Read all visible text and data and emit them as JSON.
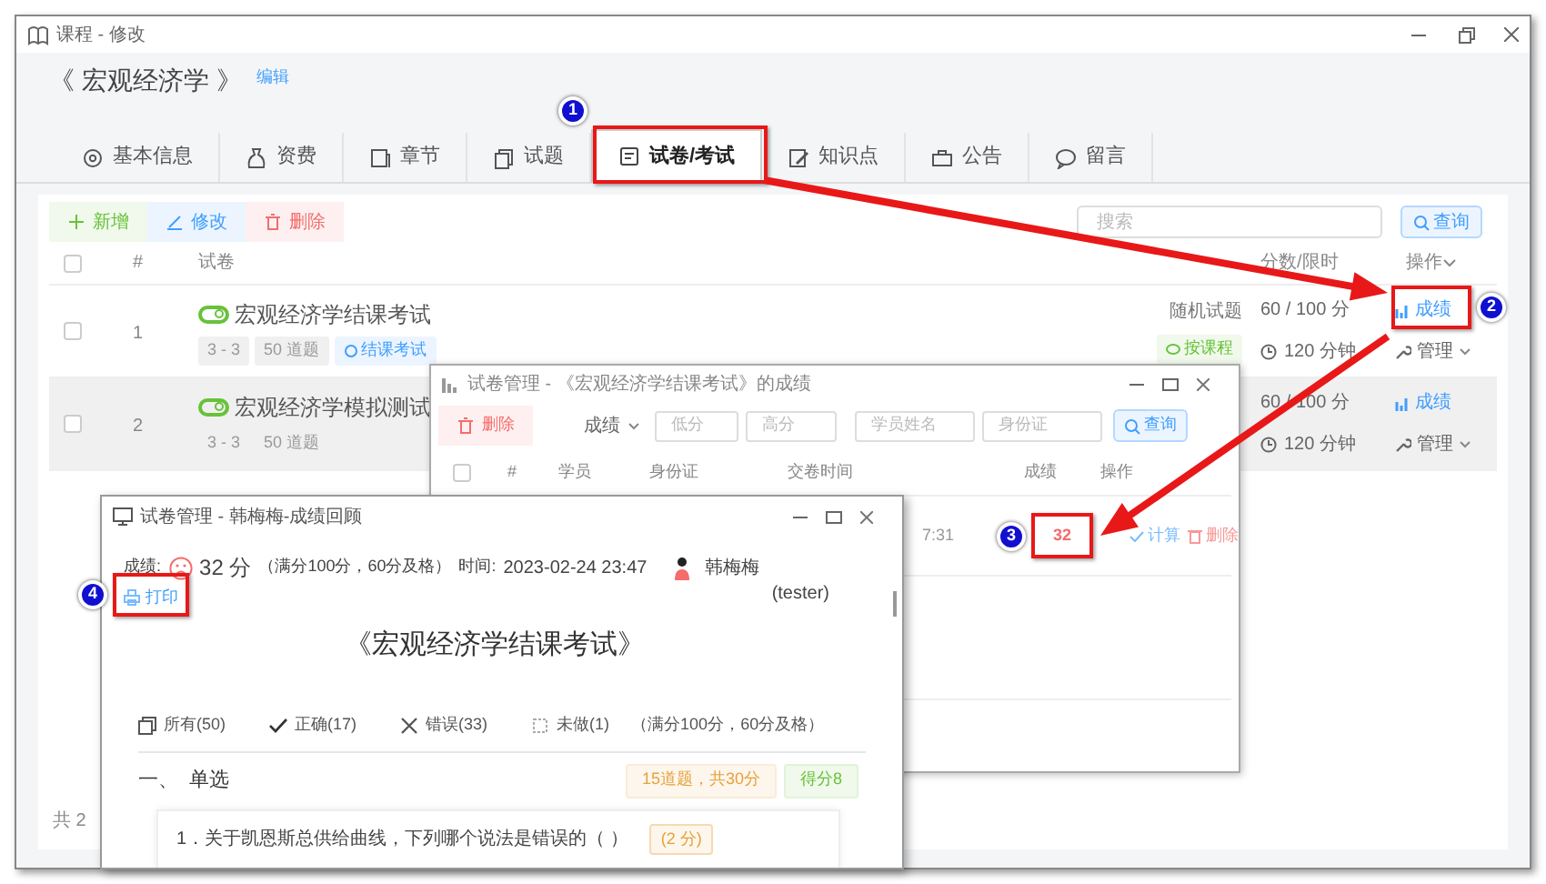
{
  "window": {
    "title": "课程 - 修改"
  },
  "course": {
    "title": "《 宏观经济学 》",
    "edit_link": "编辑"
  },
  "tabs": [
    {
      "label": "基本信息",
      "selected": false
    },
    {
      "label": "资费",
      "selected": false
    },
    {
      "label": "章节",
      "selected": false
    },
    {
      "label": "试题",
      "selected": false
    },
    {
      "label": "试卷/考试",
      "selected": true
    },
    {
      "label": "知识点",
      "selected": false
    },
    {
      "label": "公告",
      "selected": false
    },
    {
      "label": "留言",
      "selected": false
    }
  ],
  "toolbar": {
    "buttons": [
      {
        "label": "新增",
        "kind": "add"
      },
      {
        "label": "修改",
        "kind": "edit"
      },
      {
        "label": "删除",
        "kind": "delete"
      }
    ],
    "search_placeholder": "搜索",
    "search_button": "查询"
  },
  "table": {
    "select_all_checked": false,
    "columns": [
      "#",
      "试卷",
      "分数/限时",
      "操作"
    ],
    "rows": [
      {
        "checked": false,
        "index": "1",
        "title": "宏观经济学结课考试",
        "enabled": true,
        "highlighted": false,
        "tags": [
          "3 - 3",
          "50 道题"
        ],
        "tag_link": "结课考试",
        "type": "随机试题",
        "type_tag": "按课程",
        "score": "60 / 100 分",
        "time": "120 分钟",
        "actions": [
          "成绩",
          "管理"
        ]
      },
      {
        "checked": false,
        "index": "2",
        "title": "宏观经济学模拟测试",
        "enabled": true,
        "highlighted": true,
        "tags": [
          "3 - 3",
          "50 道题"
        ],
        "score": "60 / 100 分",
        "time": "120 分钟",
        "actions": [
          "成绩",
          "管理"
        ]
      }
    ],
    "footer": "共 2"
  },
  "scores_window": {
    "title": "试卷管理 - 《宏观经济学结课考试》的成绩",
    "delete_button": "删除",
    "sort": "成绩",
    "filters": [
      "低分",
      "高分",
      "学员姓名",
      "身份证"
    ],
    "query_button": "查询",
    "select_all_checked": false,
    "columns": [
      "#",
      "学员",
      "身份证",
      "交卷时间",
      "成绩",
      "操作"
    ],
    "rows": [
      {
        "time": "7:31",
        "score": "32",
        "actions": [
          "计算",
          "删除"
        ]
      }
    ]
  },
  "review_window": {
    "title": "试卷管理 - 韩梅梅-成绩回顾",
    "score_label": "成绩:",
    "passed": false,
    "score": "32 分",
    "score_note": "（满分100分，60分及格）",
    "time_label": "时间:",
    "time": "2023-02-24 23:47",
    "user_name": "韩梅梅",
    "user_id": "(tester)",
    "print": "打印",
    "exam_title": "《宏观经济学结课考试》",
    "filters": [
      {
        "label": "所有(50)",
        "kind": "all"
      },
      {
        "label": "正确(17)",
        "kind": "correct"
      },
      {
        "label": "错误(33)",
        "kind": "wrong"
      },
      {
        "label": "未做(1)",
        "kind": "undone"
      }
    ],
    "filter_note": "（满分100分，60分及格）",
    "section": {
      "title": "一、  单选",
      "count_tag": "15道题，共30分",
      "score_tag": "得分8"
    },
    "question": {
      "text": "1．关于凯恩斯总供给曲线，下列哪个说法是错误的（ ）",
      "points": "(2 分)"
    }
  },
  "annotations": [
    {
      "number": "1"
    },
    {
      "number": "2"
    },
    {
      "number": "3"
    },
    {
      "number": "4"
    }
  ]
}
